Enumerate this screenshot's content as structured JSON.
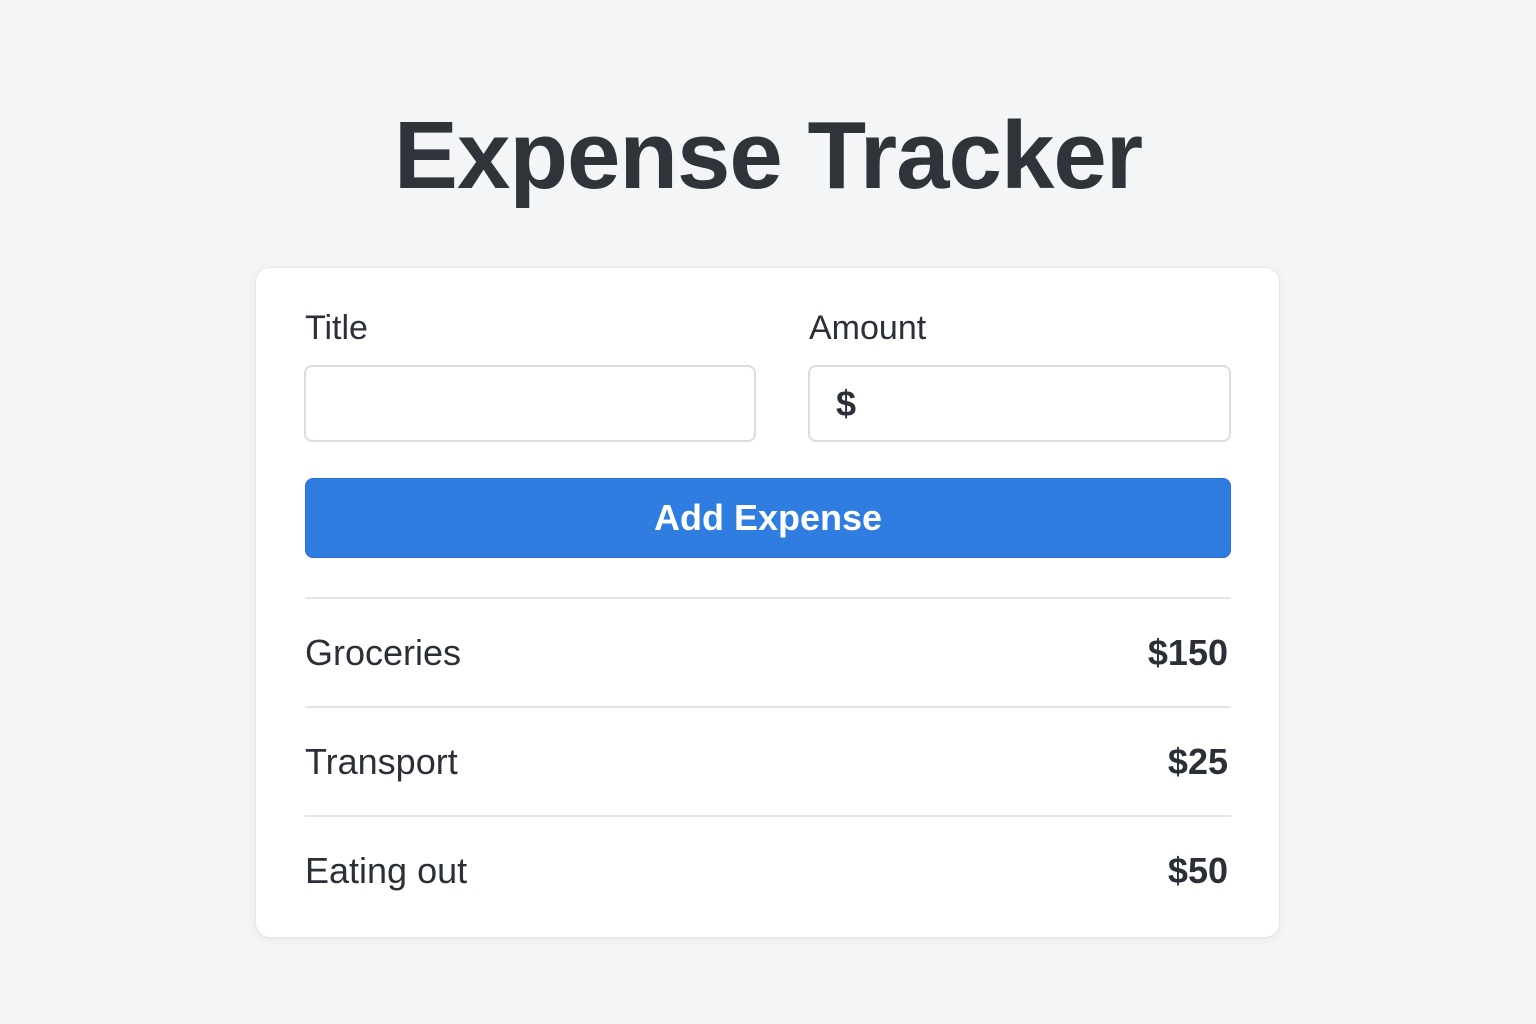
{
  "header": {
    "title": "Expense Tracker"
  },
  "form": {
    "title_label": "Title",
    "title_value": "",
    "title_placeholder": "",
    "amount_label": "Amount",
    "amount_prefix": "$",
    "amount_value": "",
    "amount_placeholder": "",
    "submit_label": "Add Expense"
  },
  "expenses": [
    {
      "title": "Groceries",
      "amount": "$150"
    },
    {
      "title": "Transport",
      "amount": "$25"
    },
    {
      "title": "Eating out",
      "amount": "$50"
    }
  ],
  "colors": {
    "background": "#f4f5f7",
    "card": "#ffffff",
    "accent": "#2f7de1",
    "text": "#2b3038",
    "divider": "#e2e4e8"
  }
}
